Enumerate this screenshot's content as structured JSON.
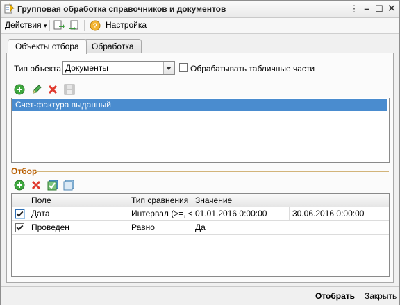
{
  "window": {
    "title": "Групповая обработка справочников и документов"
  },
  "menubar": {
    "actions_label": "Действия",
    "settings_label": "Настройка"
  },
  "tabs": [
    {
      "label": "Объекты отбора"
    },
    {
      "label": "Обработка"
    }
  ],
  "selection": {
    "object_type_label": "Тип объекта:",
    "object_type_value": "Документы",
    "process_tables_label": "Обрабатывать табличные части",
    "objects": [
      "Счет-фактура выданный"
    ]
  },
  "filter": {
    "title": "Отбор",
    "columns": [
      "Поле",
      "Тип сравнения",
      "Значение"
    ],
    "rows": [
      {
        "checked": true,
        "field": "Дата",
        "comparison": "Интервал (>=, <)",
        "value": "01.01.2016 0:00:00",
        "value2": "30.06.2016 0:00:00"
      },
      {
        "checked": true,
        "field": "Проведен",
        "comparison": "Равно",
        "value": "Да",
        "value2": ""
      }
    ]
  },
  "bottom": {
    "select_label": "Отобрать",
    "close_label": "Закрыть"
  },
  "colors": {
    "accent_selection": "#4a8ccf",
    "group_title": "#b85e00"
  }
}
